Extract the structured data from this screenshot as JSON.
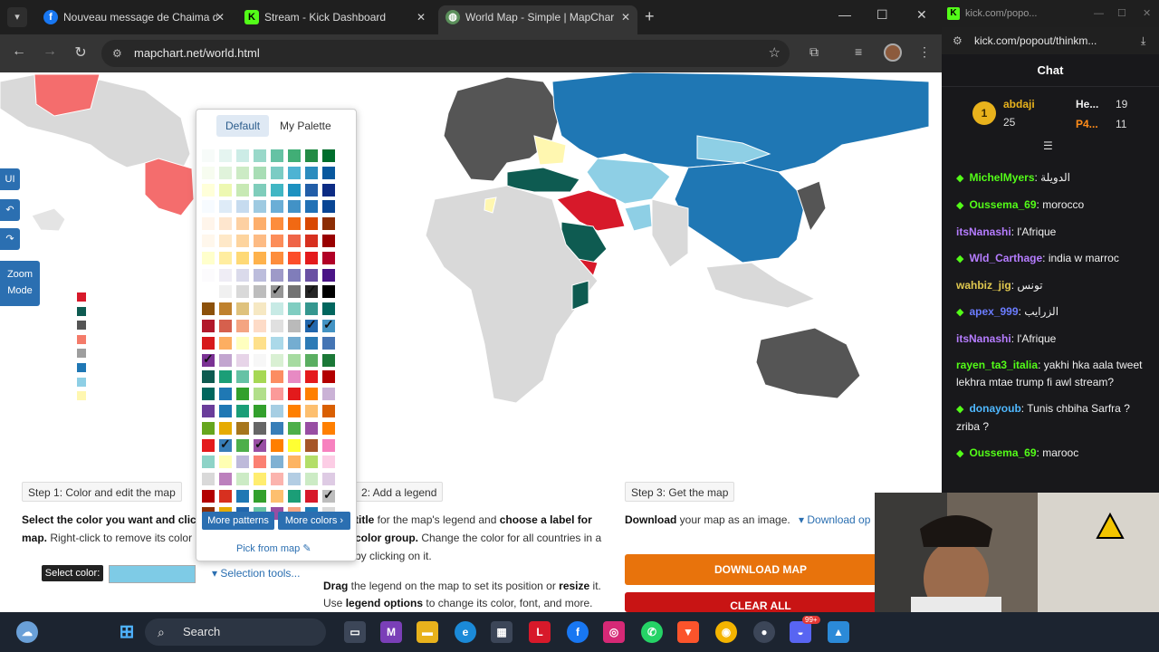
{
  "browser": {
    "tabs": [
      {
        "title": "Nouveau message de Chaima d",
        "icon": "facebook-icon",
        "active": false
      },
      {
        "title": "Stream - Kick Dashboard",
        "icon": "kick-icon",
        "active": false
      },
      {
        "title": "World Map - Simple | MapChar",
        "icon": "mapchart-icon",
        "active": true
      }
    ],
    "url": "mapchart.net/world.html"
  },
  "map_tools": {
    "ui_label": "UI",
    "zoom_label": "Zoom Mode",
    "legend_colors": [
      "#d7192a",
      "#0e5b51",
      "#555555",
      "#f47b6a",
      "#9e9e9e",
      "#1f77b4",
      "#8ecfe5",
      "#fff7b0"
    ]
  },
  "palette": {
    "tab_default": "Default",
    "tab_my_palette": "My Palette",
    "more_patterns": "More patterns",
    "more_colors": "More colors",
    "pick_from_map": "Pick from map"
  },
  "steps": {
    "step1": {
      "title": "Step 1: Color and edit the map",
      "line1_bold": "Select the color you want and click",
      "line2_bold": "map.",
      "line2_rest": " Right-click to remove its color",
      "select_color_label": "Select color:",
      "selection_tools": "Selection tools..."
    },
    "step2": {
      "title": "2: Add a legend",
      "line1_a": "title",
      "line1_b": " for the map's legend and ",
      "line1_c": "choose a label for",
      "line2_a": "color group.",
      "line2_b": " Change the color for all countries in a",
      "line3": "by clicking on it.",
      "line4_a": "Drag",
      "line4_b": " the legend on the map to set its position or ",
      "line4_c": "resize",
      "line4_d": " it.",
      "line5_a": "Use ",
      "line5_b": "legend options",
      "line5_c": " to change its color, font, and more."
    },
    "step3": {
      "title": "Step 3: Get the map",
      "line1_a": "Download",
      "line1_b": " your map as an image.",
      "download_options": "Download op",
      "download_button": "DOWNLOAD MAP",
      "clear_button": "CLEAR ALL"
    }
  },
  "chat": {
    "window_title": "kick.com/popo...",
    "url": "kick.com/popout/thinkm...",
    "header": "Chat",
    "leaderboard": [
      {
        "name": "abdaji",
        "color": "#e8b21c",
        "extra": "25",
        "right_name": "He...",
        "right_num": "19"
      },
      {
        "name": "P4...",
        "color": "#ff8c1a",
        "right_num": "11"
      }
    ],
    "messages": [
      {
        "user": "MichelMyers",
        "color": "#53fc18",
        "badge": true,
        "text": "الدويلة"
      },
      {
        "user": "Oussema_69",
        "color": "#53fc18",
        "badge": true,
        "text": "morocco"
      },
      {
        "user": "itsNanashi",
        "color": "#b57cff",
        "badge": false,
        "text": "l'Afrique"
      },
      {
        "user": "Wld_Carthage",
        "color": "#b57cff",
        "badge": true,
        "text": "india w marroc"
      },
      {
        "user": "wahbiz_jig",
        "color": "#e0c84f",
        "badge": false,
        "text": "تونس"
      },
      {
        "user": "apex_999",
        "color": "#6b7cff",
        "badge": true,
        "text": "الزرايب"
      },
      {
        "user": "itsNanashi",
        "color": "#b57cff",
        "badge": false,
        "text": "l'Afrique"
      },
      {
        "user": "rayen_ta3_italia",
        "color": "#53fc18",
        "badge": false,
        "text": "yakhi hka aala tweet lekhra mtae trump fi awl stream?"
      },
      {
        "user": "donayoub",
        "color": "#4fb8ff",
        "badge": true,
        "text": "Tunis chbiha Sarfra ? zriba ?"
      },
      {
        "user": "Oussema_69",
        "color": "#53fc18",
        "badge": true,
        "text": "marooc"
      }
    ]
  },
  "taskbar": {
    "search_placeholder": "Search",
    "badge_count": "99+"
  }
}
